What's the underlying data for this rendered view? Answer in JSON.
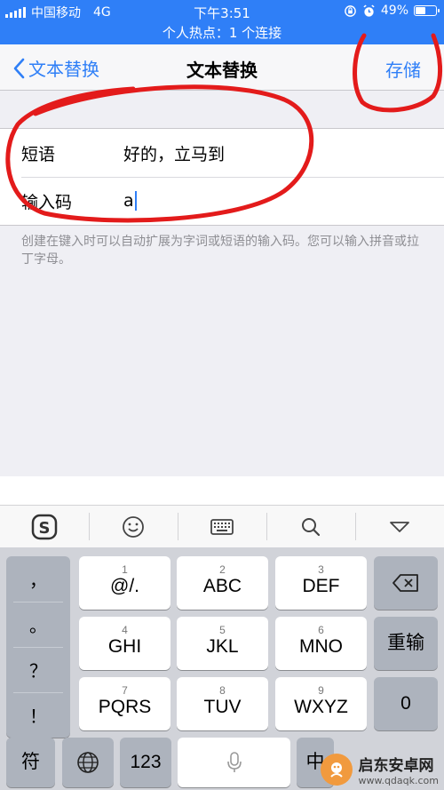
{
  "status": {
    "carrier": "中国移动",
    "network": "4G",
    "time": "下午3:51",
    "battery": "49%",
    "battery_level": 0.49,
    "hotspot": "个人热点：1 个连接"
  },
  "nav": {
    "back_label": "文本替换",
    "title": "文本替换",
    "save_label": "存储"
  },
  "form": {
    "phrase_label": "短语",
    "phrase_value": "好的，立马到",
    "shortcut_label": "输入码",
    "shortcut_value": "a",
    "hint": "创建在键入时可以自动扩展为字词或短语的输入码。您可以输入拼音或拉丁字母。"
  },
  "toolbar": {
    "icons": [
      "sogou-logo-icon",
      "emoji-icon",
      "keyboard-icon",
      "search-icon",
      "collapse-icon"
    ]
  },
  "keyboard": {
    "side_keys": [
      "，",
      "。",
      "？",
      "！"
    ],
    "keys": [
      {
        "num": "1",
        "label": "@/."
      },
      {
        "num": "2",
        "label": "ABC"
      },
      {
        "num": "3",
        "label": "DEF"
      },
      {
        "num": "4",
        "label": "GHI"
      },
      {
        "num": "5",
        "label": "JKL"
      },
      {
        "num": "6",
        "label": "MNO"
      },
      {
        "num": "7",
        "label": "PQRS"
      },
      {
        "num": "8",
        "label": "TUV"
      },
      {
        "num": "9",
        "label": "WXYZ"
      }
    ],
    "reinput": "重输",
    "zero": "0",
    "symbol": "符",
    "number_mode": "123",
    "lang_switch": "中"
  },
  "watermark": {
    "name": "启东安卓网",
    "url": "www.qdaqk.com"
  },
  "colors": {
    "accent": "#2f7ff7",
    "annotation": "#e31b1b"
  }
}
